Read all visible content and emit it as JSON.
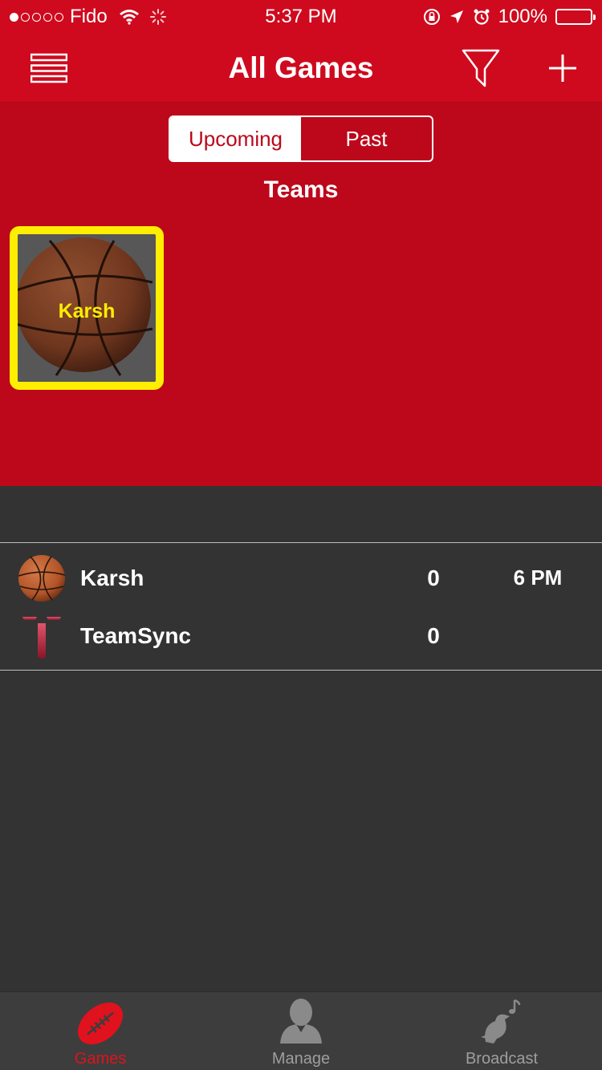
{
  "status_bar": {
    "carrier": "Fido",
    "time": "5:37 PM",
    "battery": "100%",
    "signal_bars_filled": 1,
    "signal_bars_total": 5
  },
  "nav": {
    "title": "All Games",
    "menu_icon": "menu-icon",
    "filter_icon": "filter-icon",
    "add_icon": "plus-icon"
  },
  "segments": {
    "upcoming": "Upcoming",
    "past": "Past",
    "selected": "upcoming"
  },
  "teams": {
    "heading": "Teams",
    "items": [
      {
        "name": "Karsh",
        "icon": "basketball-icon",
        "selected": true
      }
    ]
  },
  "game": {
    "home": {
      "name": "Karsh",
      "score": "0",
      "icon": "basketball-icon"
    },
    "away": {
      "name": "TeamSync",
      "score": "0",
      "icon": "teamsync-logo-icon"
    },
    "time": "6 PM"
  },
  "tabs": [
    {
      "label": "Games",
      "icon": "football-icon",
      "active": true
    },
    {
      "label": "Manage",
      "icon": "person-icon",
      "active": false
    },
    {
      "label": "Broadcast",
      "icon": "bird-icon",
      "active": false
    }
  ],
  "colors": {
    "brand_red": "#cf0a1e",
    "panel_red": "#bd071b",
    "highlight_yellow": "#ffee00",
    "background_dark": "#333333",
    "tab_active": "#e0121e"
  }
}
